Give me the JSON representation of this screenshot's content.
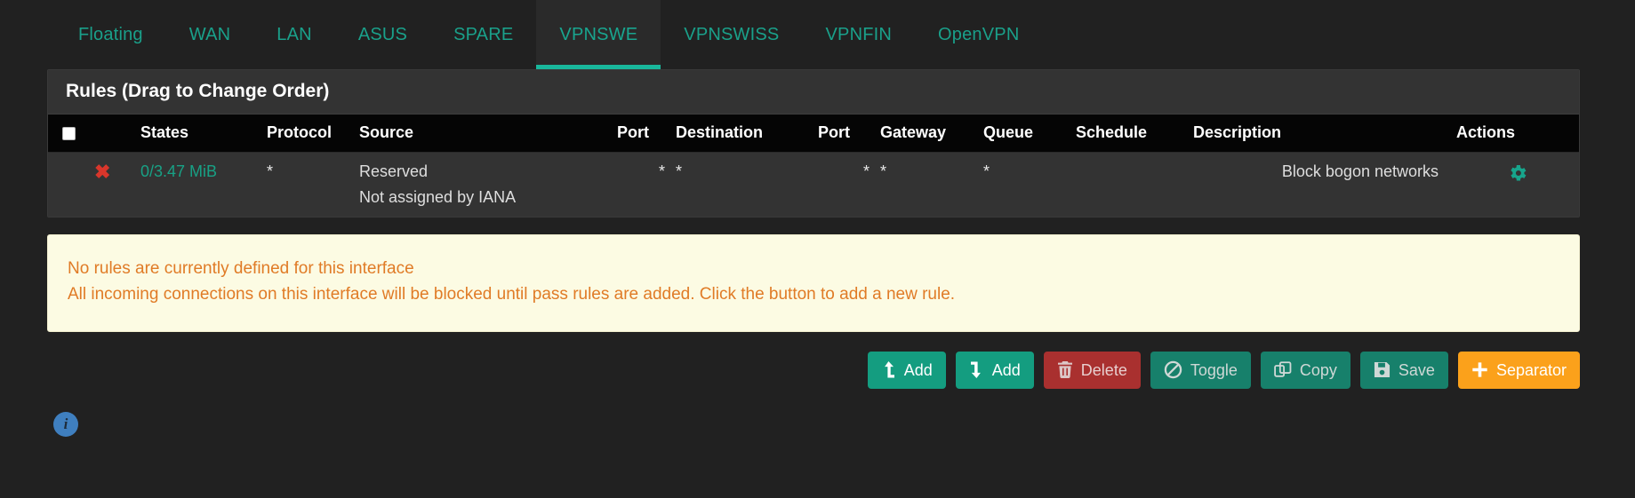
{
  "tabs": [
    {
      "label": "Floating",
      "active": false
    },
    {
      "label": "WAN",
      "active": false
    },
    {
      "label": "LAN",
      "active": false
    },
    {
      "label": "ASUS",
      "active": false
    },
    {
      "label": "SPARE",
      "active": false
    },
    {
      "label": "VPNSWE",
      "active": true
    },
    {
      "label": "VPNSWISS",
      "active": false
    },
    {
      "label": "VPNFIN",
      "active": false
    },
    {
      "label": "OpenVPN",
      "active": false
    }
  ],
  "panel": {
    "heading": "Rules (Drag to Change Order)",
    "columns": {
      "checkbox": "",
      "icon": "",
      "states": "States",
      "protocol": "Protocol",
      "source": "Source",
      "port_src": "Port",
      "destination": "Destination",
      "port_dst": "Port",
      "gateway": "Gateway",
      "queue": "Queue",
      "schedule": "Schedule",
      "description": "Description",
      "actions": "Actions"
    },
    "rows": [
      {
        "status_icon": "block-x-icon",
        "status_glyph": "✖",
        "states": "0/3.47 MiB",
        "protocol": "*",
        "source_line1": "Reserved",
        "source_line2": "Not assigned by IANA",
        "port_src": "*",
        "destination": "*",
        "port_dst": "*",
        "gateway": "*",
        "queue": "*",
        "schedule": "",
        "description": "Block bogon networks",
        "action_icon": "gear-icon"
      }
    ]
  },
  "alert": {
    "line1": "No rules are currently defined for this interface",
    "line2": "All incoming connections on this interface will be blocked until pass rules are added. Click the button to add a new rule."
  },
  "buttons": [
    {
      "label": "Add",
      "icon": "arrow-up-icon",
      "style": "btn-green"
    },
    {
      "label": "Add",
      "icon": "arrow-down-icon",
      "style": "btn-green"
    },
    {
      "label": "Delete",
      "icon": "trash-icon",
      "style": "btn-red"
    },
    {
      "label": "Toggle",
      "icon": "ban-icon",
      "style": "btn-teal"
    },
    {
      "label": "Copy",
      "icon": "copy-icon",
      "style": "btn-teal"
    },
    {
      "label": "Save",
      "icon": "save-icon",
      "style": "btn-teal"
    },
    {
      "label": "Separator",
      "icon": "plus-icon",
      "style": "btn-orange"
    }
  ],
  "footer": {
    "info_icon": "info-circle-icon",
    "info_glyph": "i"
  },
  "colors": {
    "accent_teal": "#17806b",
    "tab_link": "#1aa08a",
    "states_text": "#18a185",
    "block_red": "#d9362b",
    "alert_bg": "#fcfbe3",
    "alert_text": "#e07b26",
    "separator_orange": "#fba11b",
    "info_blue": "#3f7fbf"
  }
}
